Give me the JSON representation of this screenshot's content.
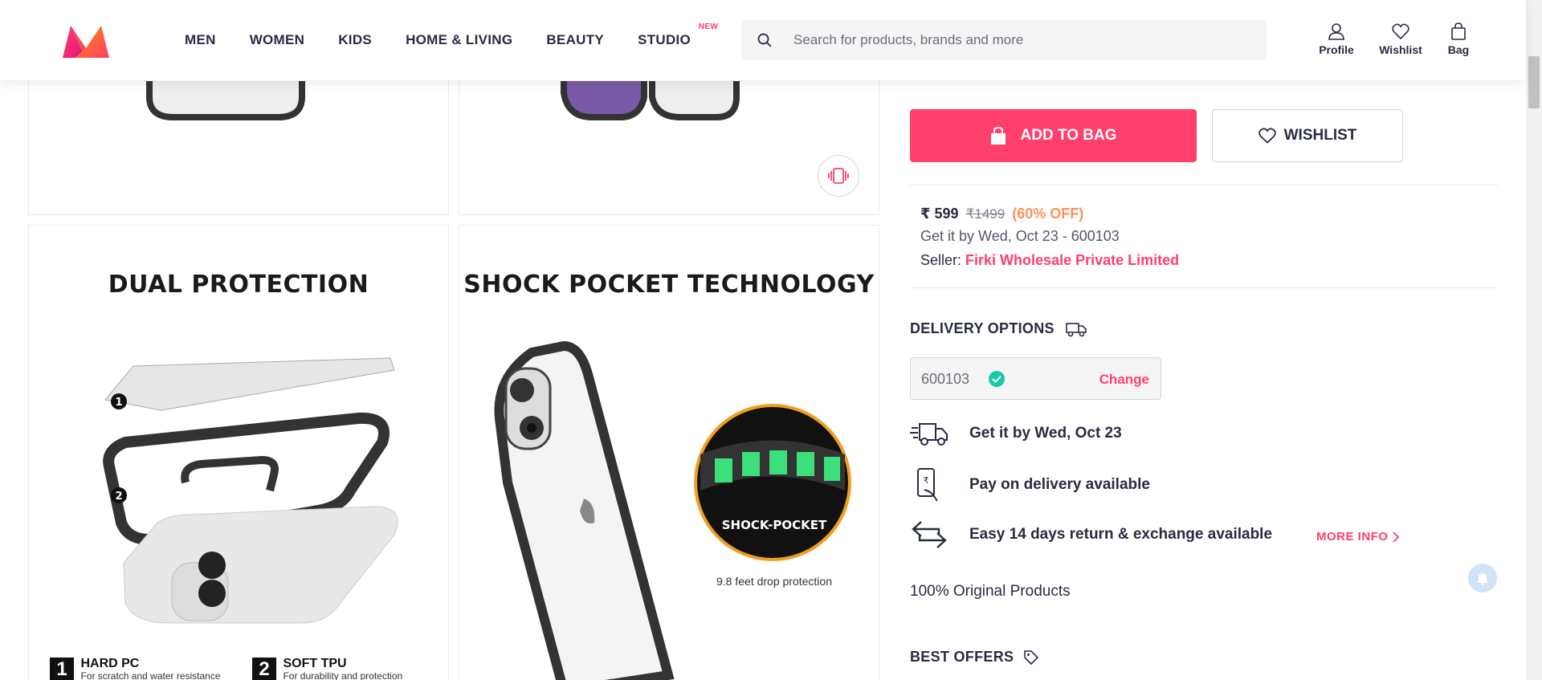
{
  "header": {
    "nav": [
      {
        "label": "MEN"
      },
      {
        "label": "WOMEN"
      },
      {
        "label": "KIDS"
      },
      {
        "label": "HOME & LIVING"
      },
      {
        "label": "BEAUTY"
      },
      {
        "label": "STUDIO",
        "badge": "NEW"
      }
    ],
    "search_placeholder": "Search for products, brands and more",
    "actions": {
      "profile": "Profile",
      "wishlist": "Wishlist",
      "bag": "Bag"
    }
  },
  "gallery": {
    "dual": {
      "title": "DUAL PROTECTION",
      "legend": [
        {
          "num": "1",
          "title": "HARD PC",
          "desc": "For scratch and water resistance"
        },
        {
          "num": "2",
          "title": "SOFT TPU",
          "desc": "For durability and protection"
        }
      ]
    },
    "shock": {
      "title": "SHOCK POCKET TECHNOLOGY",
      "badge": "SHOCK-POCKET",
      "caption": "9.8 feet drop protection"
    }
  },
  "product": {
    "add_to_bag": "ADD TO BAG",
    "wishlist": "WISHLIST",
    "price": "₹ 599",
    "mrp": "₹1499",
    "discount": "(60% OFF)",
    "get_it_by": "Get it by Wed, Oct 23 - 600103",
    "seller_label": "Seller:",
    "seller_name": "Firki Wholesale Private Limited"
  },
  "delivery": {
    "title": "DELIVERY OPTIONS",
    "pincode": "600103",
    "change": "Change",
    "items": [
      {
        "icon": "delivery-truck-icon",
        "label": "Get it by Wed, Oct 23"
      },
      {
        "icon": "pay-on-delivery-icon",
        "label": "Pay on delivery available"
      },
      {
        "icon": "return-exchange-icon",
        "label": "Easy 14 days return & exchange available"
      }
    ],
    "more_info": "MORE INFO",
    "original": "100% Original Products",
    "best_offers": "BEST OFFERS"
  },
  "colors": {
    "brand": "#ff3f6c",
    "discount": "#ff905a",
    "text": "#282c3f",
    "success": "#14cda8"
  }
}
